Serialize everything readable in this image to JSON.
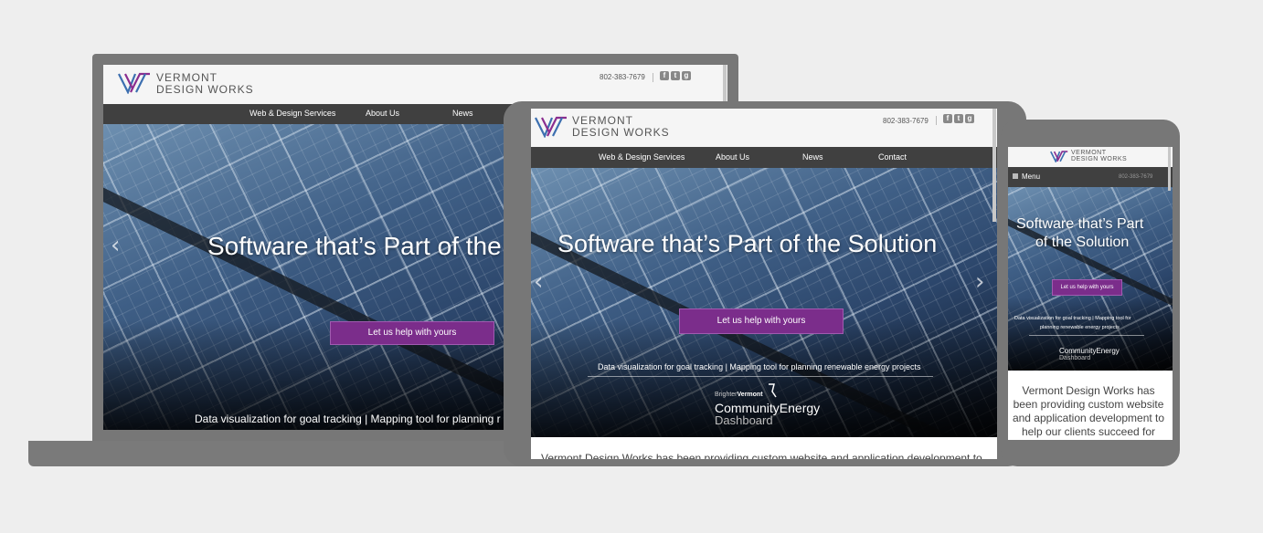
{
  "brand": {
    "line1": "VERMONT",
    "line2": "DESIGN WORKS"
  },
  "phone": "802-383-7679",
  "nav": [
    "Web & Design Services",
    "About Us",
    "News",
    "Contact"
  ],
  "menu_label": "Menu",
  "hero": {
    "headline": "Software that’s Part of the Solution",
    "headline_laptop": "Software that’s Part of the",
    "phone_line1": "Software that’s Part",
    "phone_line2": "of the Solution",
    "cta": "Let us help with yours",
    "sub": "Data visualization for goal tracking  |  Mapping tool for planning renewable energy projects",
    "sub_laptop": "Data visualization for goal tracking  |  Mapping tool for planning r",
    "phone_sub1": "Data visualization for goal tracking  |  Mapping tool for",
    "phone_sub2": "planning renewable energy projects"
  },
  "project": {
    "prefix": "Brighter",
    "prefix2": "Vermont",
    "title": "CommunityEnergy",
    "subtitle": "Dashboard"
  },
  "body": {
    "tablet": "Vermont Design Works has been providing custom website and application development to",
    "phone": [
      "Vermont Design Works has",
      "been providing custom website",
      "and application development to",
      "help our clients succeed for"
    ]
  },
  "icons": {
    "facebook": "f",
    "twitter": "t",
    "google": "g"
  },
  "colors": {
    "accent": "#7b2d8b",
    "nav": "#404040",
    "device": "#777777",
    "background": "#eeeeee"
  }
}
